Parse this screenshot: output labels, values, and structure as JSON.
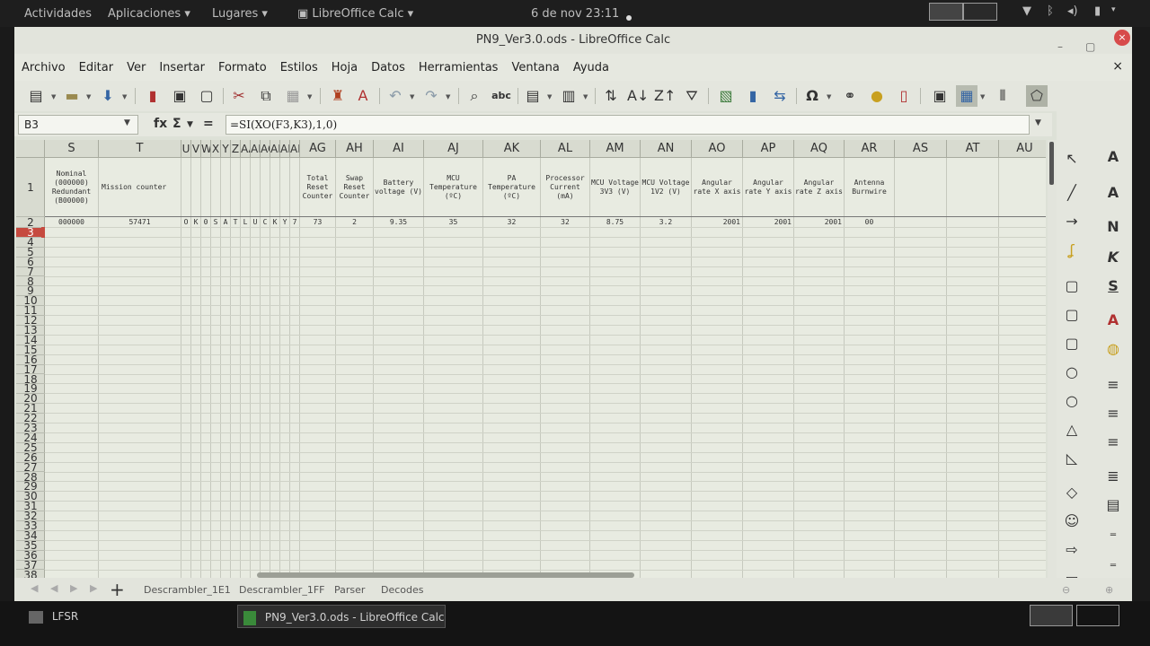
{
  "topbar": {
    "activities": "Actividades",
    "applications": "Aplicaciones ▾",
    "places": "Lugares ▾",
    "app_menu": "LibreOffice Calc ▾",
    "clock": "6 de nov 23:11"
  },
  "window": {
    "title": "PN9_Ver3.0.ods - LibreOffice Calc",
    "minimize": "–",
    "maximize": "▢",
    "close": "×",
    "doc_close": "×"
  },
  "menu": [
    "Archivo",
    "Editar",
    "Ver",
    "Insertar",
    "Formato",
    "Estilos",
    "Hoja",
    "Datos",
    "Herramientas",
    "Ventana",
    "Ayuda"
  ],
  "formula_bar": {
    "name_box": "B3",
    "fx": "fx",
    "sigma": "Σ",
    "equals": "=",
    "formula": "=SI(XO(F3,K3),1,0)"
  },
  "columns": [
    "S",
    "T",
    "U",
    "V",
    "W",
    "X",
    "Y",
    "Z",
    "AA",
    "AB",
    "AC",
    "AD",
    "AE",
    "AF",
    "AG",
    "AH",
    "AI",
    "AJ",
    "AK",
    "AL",
    "AM",
    "AN",
    "AO",
    "AP",
    "AQ",
    "AR",
    "AS",
    "AT",
    "AU"
  ],
  "rows": [
    "1",
    "2",
    "3",
    "4",
    "5",
    "6",
    "7",
    "8",
    "9",
    "10",
    "11",
    "12",
    "13",
    "14",
    "15",
    "16",
    "17",
    "18",
    "19",
    "20",
    "21",
    "22",
    "23",
    "24",
    "25",
    "26",
    "27",
    "28",
    "29",
    "30",
    "31",
    "32",
    "33",
    "34",
    "35",
    "36",
    "37",
    "38"
  ],
  "headers_row1": {
    "S": "Nominal (000000) Redundant (B00000)",
    "T": "Mission counter",
    "AG": "Total Reset Counter",
    "AH": "Swap Reset Counter",
    "AI": "Battery voltage (V)",
    "AJ": "MCU Temperature (ºC)",
    "AK": "PA Temperature (ºC)",
    "AL": "Processor Current (mA)",
    "AM": "MCU Voltage 3V3 (V)",
    "AN": "MCU Voltage 1V2 (V)",
    "AO": "Angular rate X axis",
    "AP": "Angular rate Y axis",
    "AQ": "Angular rate Z axis",
    "AR": "Antenna Burnwire"
  },
  "row2": {
    "S": "000000",
    "T": "57471",
    "U": "O",
    "V": "K",
    "W": "0",
    "X": "S",
    "Y": "A",
    "Z": "T",
    "AA": "L",
    "AB": "U",
    "AC": "C",
    "AD": "K",
    "AE": "Y",
    "AF": "7",
    "AG": "73",
    "AH": "2",
    "AI": "9.35",
    "AJ": "35",
    "AK": "32",
    "AL": "32",
    "AM": "8.75",
    "AN": "3.2",
    "AO": "2001",
    "AP": "2001",
    "AQ": "2001",
    "AR": "00"
  },
  "sheet_tabs": [
    "Descrambler_1E1",
    "Descrambler_1FF",
    "Parser",
    "Decodes"
  ],
  "taskbar": {
    "task1": "LFSR",
    "task2": "PN9_Ver3.0.ods - LibreOffice Calc"
  },
  "colors": {
    "accent": "#c64a3f",
    "sheet_bg": "#e8ebe1",
    "header_bg": "#d8dbd0"
  }
}
